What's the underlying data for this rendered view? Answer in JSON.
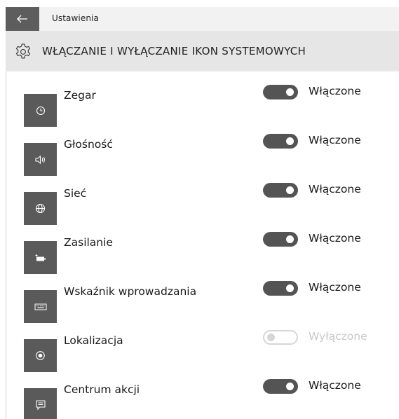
{
  "app": {
    "title": "Ustawienia"
  },
  "header": {
    "page_title": "WŁĄCZANIE I WYŁĄCZANIE IKON SYSTEMOWYCH",
    "icon": "gear-icon"
  },
  "colors": {
    "tile": "#5a5a5a",
    "toggle_on": "#545454",
    "toggle_off_border": "#d6d6d6",
    "header_bg": "#e6e6e6",
    "titlebar_bg": "#f2f2f2",
    "back_button_bg": "#5d5d5d"
  },
  "settings": [
    {
      "label": "Zegar",
      "icon": "clock-icon",
      "state": "on",
      "state_label": "Włączone"
    },
    {
      "label": "Głośność",
      "icon": "speaker-icon",
      "state": "on",
      "state_label": "Włączone"
    },
    {
      "label": "Sieć",
      "icon": "globe-icon",
      "state": "on",
      "state_label": "Włączone"
    },
    {
      "label": "Zasilanie",
      "icon": "battery-icon",
      "state": "on",
      "state_label": "Włączone"
    },
    {
      "label": "Wskaźnik wprowadzania",
      "icon": "keyboard-icon",
      "state": "on",
      "state_label": "Włączone"
    },
    {
      "label": "Lokalizacja",
      "icon": "location-icon",
      "state": "off",
      "state_label": "Wyłączone"
    },
    {
      "label": "Centrum akcji",
      "icon": "action-center-icon",
      "state": "on",
      "state_label": "Włączone"
    }
  ]
}
